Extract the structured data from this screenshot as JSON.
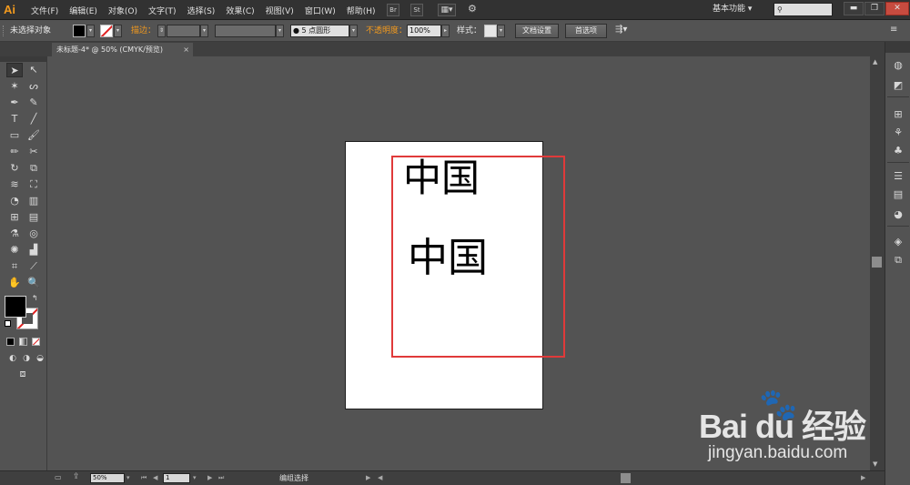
{
  "app": {
    "logo": "Ai"
  },
  "menu": [
    "文件(F)",
    "编辑(E)",
    "对象(O)",
    "文字(T)",
    "选择(S)",
    "效果(C)",
    "视图(V)",
    "窗口(W)",
    "帮助(H)"
  ],
  "menubar_buttons": {
    "br": "Br",
    "st": "St"
  },
  "workspace": {
    "label": "基本功能",
    "arrow": "▾"
  },
  "search": {
    "icon": "search-icon",
    "placeholder": ""
  },
  "window_controls": {
    "minimize": "▬",
    "restore": "❐",
    "close": "✕"
  },
  "control": {
    "selection_status": "未选择对象",
    "stroke_label": "描边：",
    "brush_label": "5 点圆形",
    "opacity_label": "不透明度：",
    "opacity_value": "100%",
    "style_label": "样式：",
    "doc_setup": "文档设置",
    "preferences": "首选项"
  },
  "document": {
    "tab_title": "未标题-4* @ 50% (CMYK/预览)",
    "close": "×"
  },
  "canvas_text": {
    "line1": "中国",
    "line2": "中国"
  },
  "status": {
    "zoom": "50%",
    "page": "1",
    "info": "编组选择"
  },
  "watermark": {
    "brand": "Bai du 经验",
    "url": "jingyan.baidu.com"
  },
  "colors": {
    "accent": "#f39a1e",
    "red_frame": "#e03a3a",
    "fill": "#000000",
    "stroke": "none"
  }
}
